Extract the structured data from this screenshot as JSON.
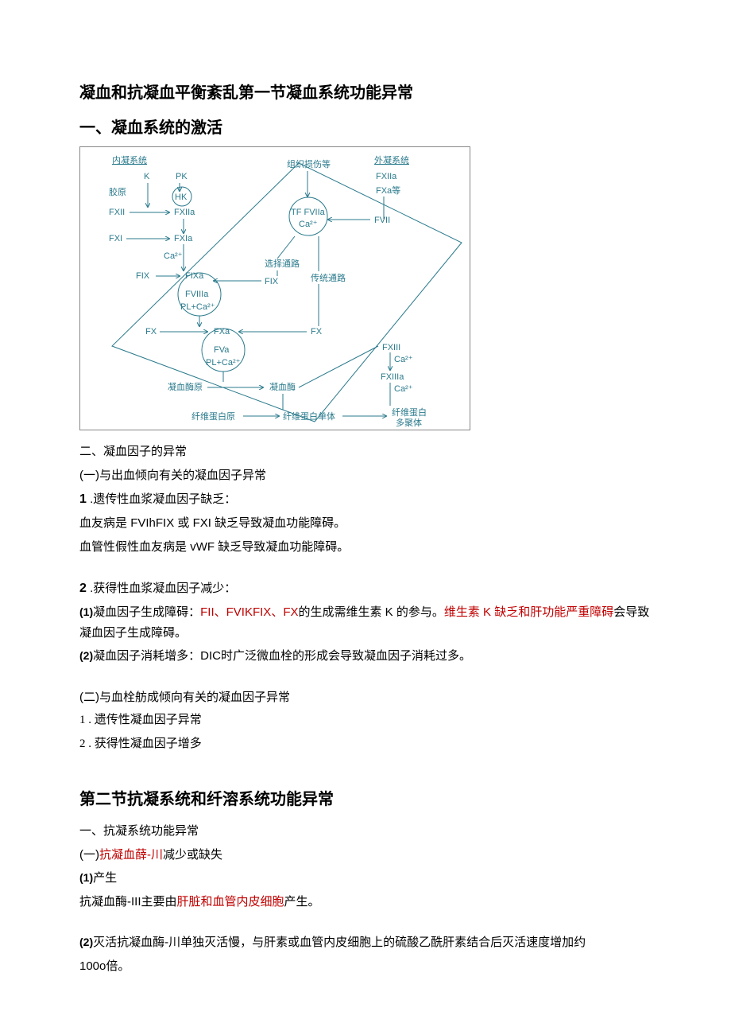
{
  "title": "凝血和抗凝血平衡紊乱第一节凝血系统功能异常",
  "h_activation": "一、凝血系统的激活",
  "diagram": {
    "intrinsic": "内凝系统",
    "extrinsic": "外凝系统",
    "tissue_injury": "组织损伤等",
    "K": "K",
    "PK": "PK",
    "HK": "HK",
    "collagen": "胶原",
    "FXII": "FXII",
    "FXIIa": "FXIIa",
    "FXI": "FXI",
    "FXIa": "FXIa",
    "Ca2": "Ca²⁺",
    "FIX": "FIX",
    "FIXa": "FIXa",
    "FVIIIa": "FVIIIa",
    "PLCa": "PL+Ca²⁺",
    "FX": "FX",
    "FXa": "FXa",
    "FVa": "FVa",
    "select_path": "选择通路",
    "trad_path": "传统通路",
    "TF_FVIIa": "TF  FVIIa",
    "FVII": "FVII",
    "FXa_etc": "FXa等",
    "prothrombin": "凝血酶原",
    "thrombin": "凝血酶",
    "fibrinogen": "纤维蛋白原",
    "fibrin_monomer": "纤维蛋白单体",
    "fibrin_polymer_1": "纤维蛋白",
    "fibrin_polymer_2": "多聚体",
    "FXIII": "FXIII",
    "FXIIIa": "FXIIIa"
  },
  "s2_h": "二、凝血因子的异常",
  "s2_a": "(一)与出血倾向有关的凝血因子异常",
  "s2_1_num": "1",
  "s2_1": ".遗传性血浆凝血因子缺乏：",
  "s2_1_line1_a": "血友病是",
  "s2_1_line1_b": "FVIhFIX",
  "s2_1_line1_c": "或",
  "s2_1_line1_d": "FXI",
  "s2_1_line1_e": "缺乏导致凝血功能障碍。",
  "s2_1_line2_a": "血管性假性血友病是",
  "s2_1_line2_b": "vWF",
  "s2_1_line2_c": "缺乏导致凝血功能障碍。",
  "s2_2_num": "2",
  "s2_2": ".获得性血浆凝血因子减少：",
  "s2_2_p1_a": "凝血因子生成障碍：",
  "s2_2_p1_b": "FII、FVIKFIX、FX",
  "s2_2_p1_c": "的生成需维生素",
  "s2_2_p1_d": "K",
  "s2_2_p1_e": "的参与。",
  "s2_2_p1_red": "维生素 K 缺乏和肝功能严重障碍",
  "s2_2_p1_f": "会导致凝血因子生成障碍。",
  "s2_2_p2_num": "(2)",
  "s2_2_p1_num": "(1)",
  "s2_2_p2_a": "凝血因子消耗增多：",
  "s2_2_p2_b": "DIC",
  "s2_2_p2_c": "时广泛微血栓的形成会导致凝血因子消耗过多。",
  "s2_b": "(二)与血栓舫成倾向有关的凝血因子异常",
  "s2_b_1": "1 . 遗传性凝血因子异常",
  "s2_b_2": "2 . 获得性凝血因子增多",
  "section2_title": "第二节抗凝系统和纤溶系统功能异常",
  "s2n_a": "一、抗凝系统功能异常",
  "s2n_b_label": "(一)",
  "s2n_b_red": "抗凝血薛-川",
  "s2n_b_rest": "减少或缺失",
  "s2n_1_num": "(1)",
  "s2n_1_label": "产生",
  "s2n_1_text_a": "抗凝血酶-",
  "s2n_1_text_b": "III",
  "s2n_1_text_c": "主要由",
  "s2n_1_text_red": "肝脏和血管内皮细胞",
  "s2n_1_text_d": "产生。",
  "s2n_2_num": "(2)",
  "s2n_2_text": "灭活抗凝血酶-川单独灭活慢，与肝素或血管内皮细胞上的硫酸乙酰肝素结合后灭活速度增加约",
  "s2n_2_line2_a": "100o",
  "s2n_2_line2_b": "倍。"
}
